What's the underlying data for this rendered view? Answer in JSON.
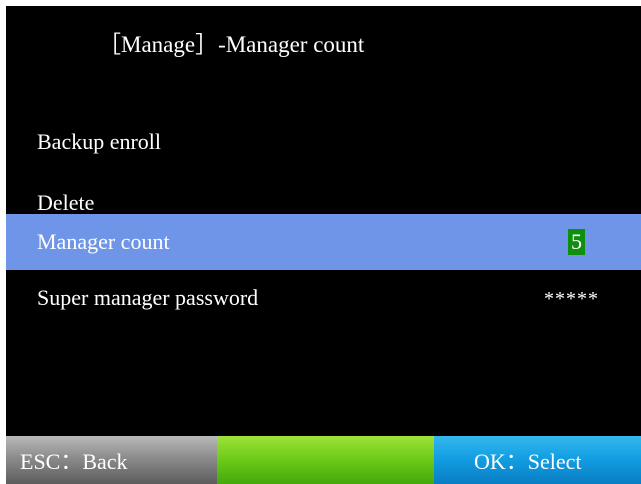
{
  "header": {
    "title": "［Manage］-Manager count"
  },
  "menu": {
    "items": [
      {
        "label": "Backup enroll",
        "value": ""
      },
      {
        "label": "Delete",
        "value": ""
      },
      {
        "label": "Manager count",
        "value": "5",
        "selected": true
      },
      {
        "label": "Super manager password",
        "value": "*****"
      }
    ]
  },
  "footer": {
    "esc_label": "ESC：Back",
    "mid_label": "",
    "ok_label": "OK：Select"
  },
  "colors": {
    "background": "#000000",
    "selected_row": "#6f95e8",
    "value_highlight": "#0f8f0f",
    "esc_button": "#8c8c8c",
    "mid_button": "#6fcd1a",
    "ok_button": "#139fe3"
  }
}
